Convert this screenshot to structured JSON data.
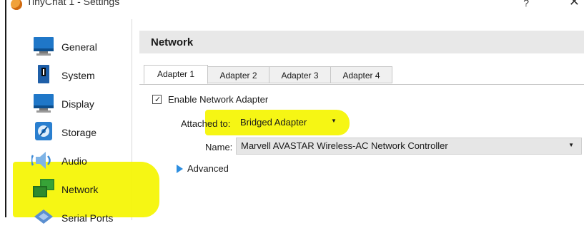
{
  "window": {
    "title": "TinyChat 1 - Settings",
    "help": "?",
    "close": "✕"
  },
  "sidebar": {
    "items": [
      {
        "label": "General",
        "icon": "general-icon"
      },
      {
        "label": "System",
        "icon": "system-icon"
      },
      {
        "label": "Display",
        "icon": "display-icon"
      },
      {
        "label": "Storage",
        "icon": "storage-icon"
      },
      {
        "label": "Audio",
        "icon": "audio-icon"
      },
      {
        "label": "Network",
        "icon": "network-icon",
        "selected": true
      },
      {
        "label": "Serial Ports",
        "icon": "serial-ports-icon"
      }
    ]
  },
  "section": {
    "title": "Network"
  },
  "tabs": [
    {
      "label": "Adapter 1",
      "active": true
    },
    {
      "label": "Adapter 2"
    },
    {
      "label": "Adapter 3"
    },
    {
      "label": "Adapter 4"
    }
  ],
  "form": {
    "enable_label": "Enable Network Adapter",
    "enable_checked": true,
    "attached_label": "Attached to:",
    "attached_value": "Bridged Adapter",
    "name_label": "Name:",
    "name_value": "Marvell AVASTAR Wireless-AC Network Controller",
    "advanced_label": "Advanced"
  },
  "colors": {
    "highlight": "#f5f500",
    "accent": "#2d8ee0",
    "header_bg": "#e8e8e8"
  }
}
